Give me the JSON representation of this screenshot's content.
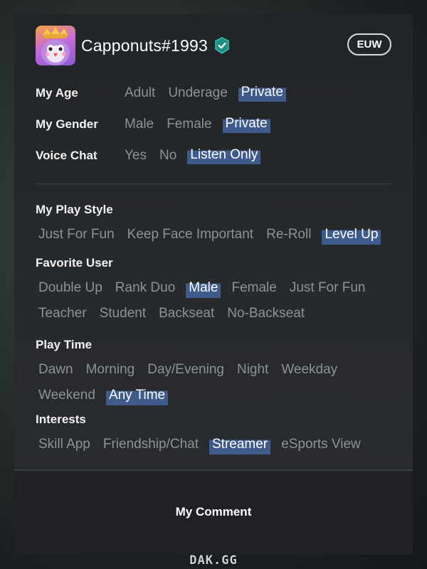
{
  "profile": {
    "username": "Capponuts#1993",
    "region": "EUW",
    "avatar_icon": "penguin-avatar-icon",
    "verified_icon": "verified-shield-icon"
  },
  "attributes": [
    {
      "label": "My Age",
      "options": [
        "Adult",
        "Underage",
        "Private"
      ],
      "selected": "Private"
    },
    {
      "label": "My Gender",
      "options": [
        "Male",
        "Female",
        "Private"
      ],
      "selected": "Private"
    },
    {
      "label": "Voice Chat",
      "options": [
        "Yes",
        "No",
        "Listen Only"
      ],
      "selected": "Listen Only"
    }
  ],
  "sections": {
    "play_style": {
      "title": "My Play Style",
      "tags": [
        "Just For Fun",
        "Keep Face Important",
        "Re-Roll",
        "Level Up"
      ],
      "selected": [
        "Level Up"
      ]
    },
    "favorite_user": {
      "title": "Favorite User",
      "tags": [
        "Double Up",
        "Rank Duo",
        "Male",
        "Female",
        "Just For Fun",
        "Teacher",
        "Student",
        "Backseat",
        "No-Backseat"
      ],
      "selected": [
        "Male"
      ]
    },
    "play_time": {
      "title": "Play Time",
      "tags": [
        "Dawn",
        "Morning",
        "Day/Evening",
        "Night",
        "Weekday",
        "Weekend",
        "Any Time"
      ],
      "selected": [
        "Any Time"
      ]
    },
    "interests": {
      "title": "Interests",
      "tags": [
        "Skill App",
        "Friendship/Chat",
        "Streamer",
        "eSports View"
      ],
      "selected": [
        "Streamer"
      ]
    }
  },
  "comment": {
    "title": "My Comment"
  },
  "watermark": "DAK.GG",
  "colors": {
    "selected_highlight": "#3e5b8c",
    "unselected_text": "#8e9297",
    "verified_badge": "#2fb3a3"
  }
}
